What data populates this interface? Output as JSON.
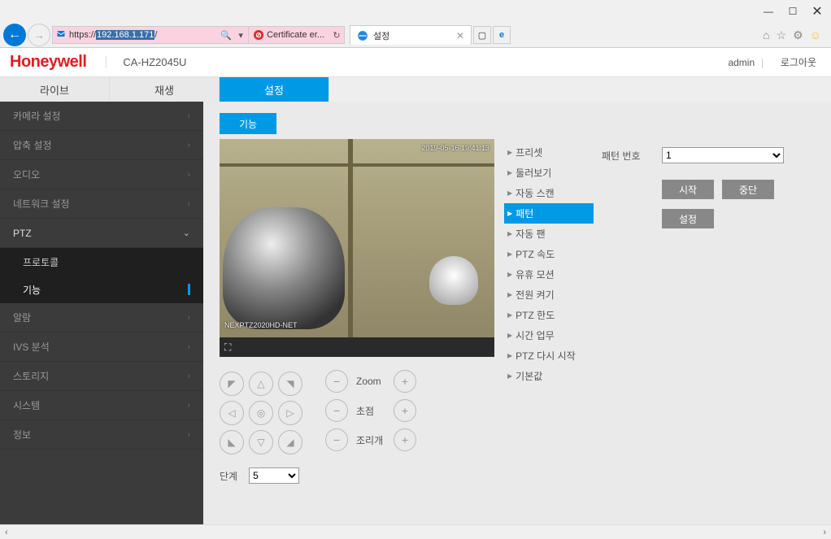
{
  "browser": {
    "url": "https://192.168.1.171/",
    "url_display_prefix": "https://",
    "url_display_host": "192.168.1.171",
    "url_display_suffix": "/",
    "cert_error": "Certificate er...",
    "tab_title": "설정",
    "search_placeholder": ""
  },
  "header": {
    "brand": "Honeywell",
    "model": "CA-HZ2045U",
    "user": "admin",
    "logout": "로그아웃"
  },
  "top_tabs": {
    "live": "라이브",
    "playback": "재생",
    "settings": "설정"
  },
  "sidebar": {
    "items": [
      {
        "label": "카메라 설정",
        "expanded": false
      },
      {
        "label": "압축 설정",
        "expanded": false
      },
      {
        "label": "오디오",
        "expanded": false
      },
      {
        "label": "네트워크 설정",
        "expanded": false
      },
      {
        "label": "PTZ",
        "expanded": true,
        "sub": [
          {
            "label": "프로토콜",
            "active": false
          },
          {
            "label": "기능",
            "active": true
          }
        ]
      },
      {
        "label": "알람",
        "expanded": false
      },
      {
        "label": "IVS 분석",
        "expanded": false
      },
      {
        "label": "스토리지",
        "expanded": false
      },
      {
        "label": "시스템",
        "expanded": false
      },
      {
        "label": "정보",
        "expanded": false
      }
    ]
  },
  "section_tab": "기능",
  "video": {
    "timestamp_overlay": "2019-05-16 19:41:13",
    "model_overlay": "NEXPTZ2020HD-NET"
  },
  "zoom_labels": {
    "zoom": "Zoom",
    "focus": "초점",
    "iris": "조리개"
  },
  "step": {
    "label": "단계",
    "value": "5"
  },
  "ptz_menu": [
    "프리셋",
    "둘러보기",
    "자동 스캔",
    "패턴",
    "자동 팬",
    "PTZ 속도",
    "유휴 모션",
    "전원 켜기",
    "PTZ 한도",
    "시간 업무",
    "PTZ 다시 시작",
    "기본값"
  ],
  "ptz_menu_selected_index": 3,
  "right": {
    "pattern_no_label": "패턴 번호",
    "pattern_no_value": "1",
    "btn_start": "시작",
    "btn_stop": "중단",
    "btn_set": "설정"
  }
}
